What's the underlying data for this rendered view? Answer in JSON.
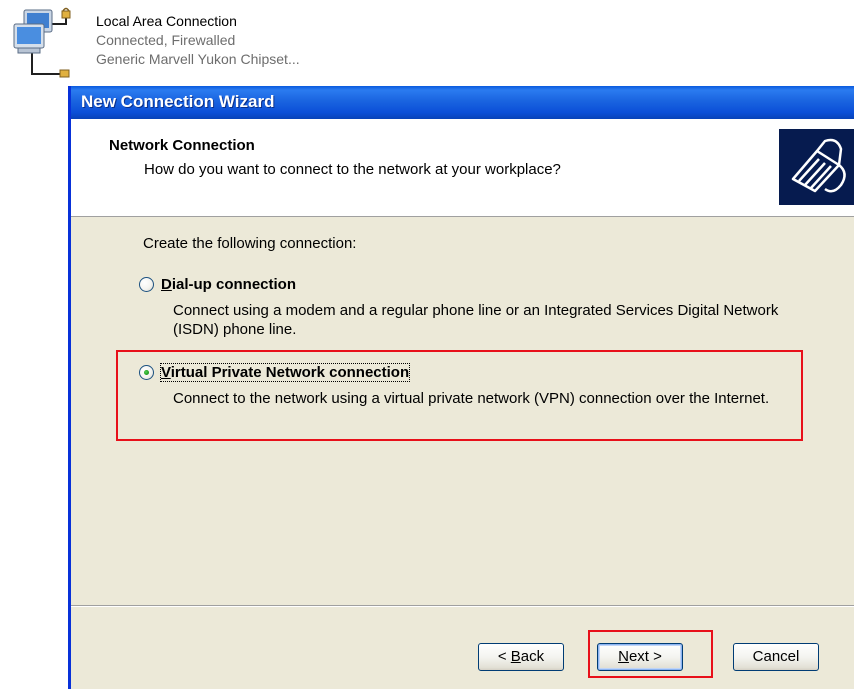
{
  "network_item": {
    "name": "Local Area Connection",
    "status": "Connected, Firewalled",
    "adapter": "Generic Marvell Yukon Chipset..."
  },
  "wizard": {
    "title": "New Connection Wizard",
    "header_title": "Network Connection",
    "header_subtitle": "How do you want to connect to the network at your workplace?",
    "lead": "Create the following connection:",
    "options": [
      {
        "label_accel": "D",
        "label_rest": "ial-up connection",
        "description": "Connect using a modem and a regular phone line or an Integrated Services Digital Network (ISDN) phone line.",
        "selected": false
      },
      {
        "label_accel": "V",
        "label_rest": "irtual Private Network connection",
        "description": "Connect to the network using a virtual private network (VPN) connection over the Internet.",
        "selected": true
      }
    ],
    "buttons": {
      "back_prefix": "< ",
      "back_accel": "B",
      "back_rest": "ack",
      "next_accel": "N",
      "next_rest": "ext >",
      "cancel": "Cancel"
    }
  },
  "colors": {
    "highlight": "#e8101a",
    "titlebar": "#0b4fd8",
    "dialog_bg": "#ece9d8"
  }
}
